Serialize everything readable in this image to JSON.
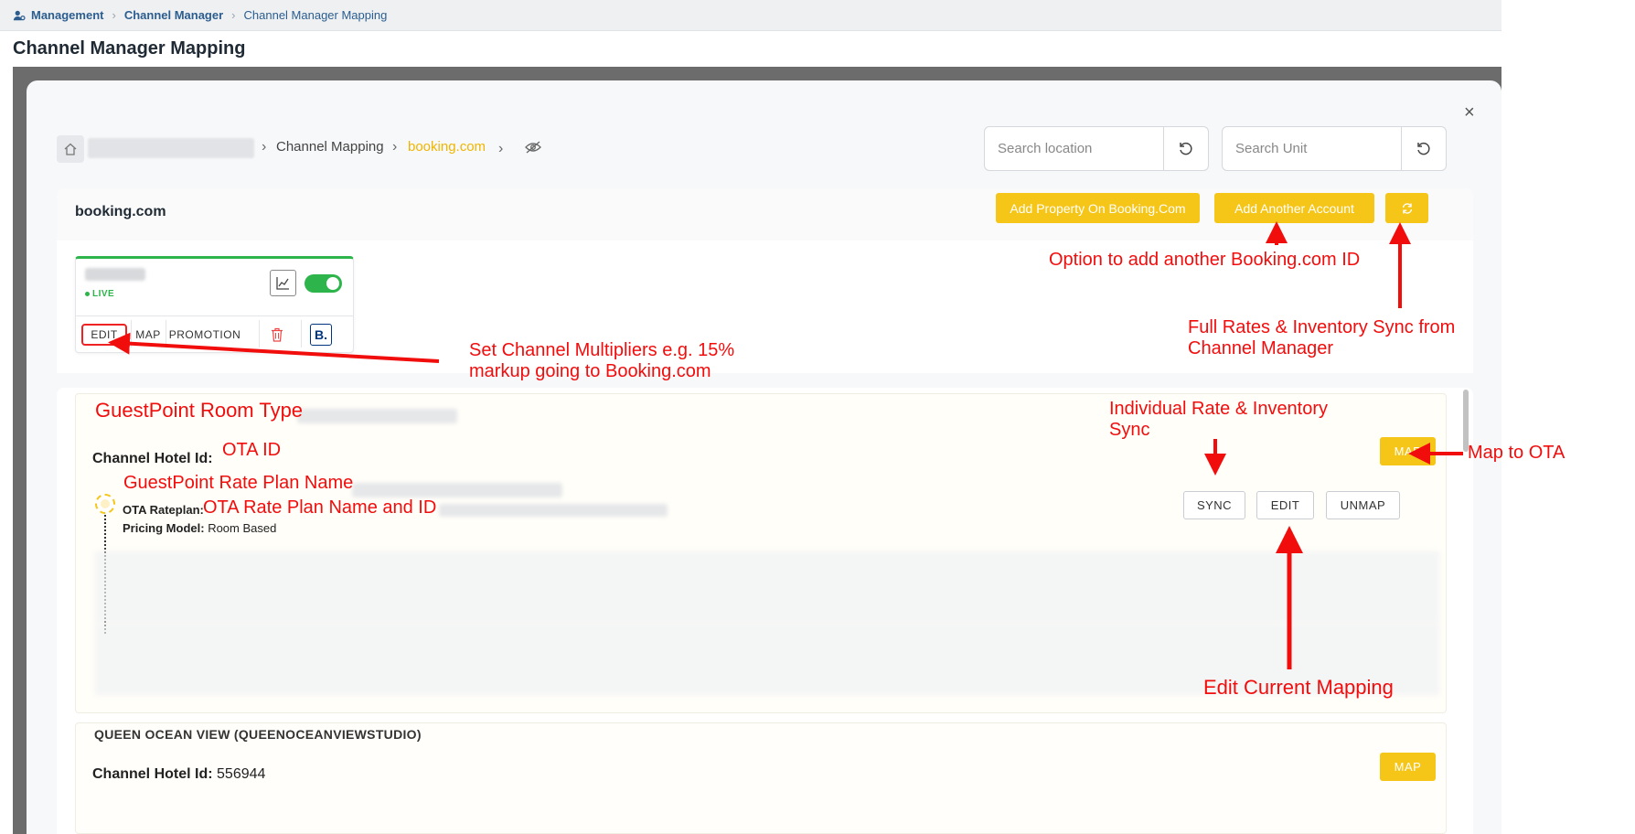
{
  "topbar": {
    "crumbs": [
      "Management",
      "Channel Manager",
      "Channel Manager Mapping"
    ]
  },
  "page": {
    "title": "Channel Manager Mapping"
  },
  "modal": {
    "close": "×",
    "breadcrumb": {
      "channel_mapping": "Channel Mapping",
      "provider": "booking.com"
    },
    "search_location": {
      "placeholder": "Search location"
    },
    "search_unit": {
      "placeholder": "Search Unit"
    }
  },
  "account": {
    "title": "booking.com",
    "add_property_label": "Add Property On Booking.Com",
    "add_account_label": "Add Another Account",
    "status": "LIVE",
    "actions": {
      "edit": "EDIT",
      "map": "MAP",
      "promotion": "PROMOTION",
      "booking_logo": "B."
    }
  },
  "rooms": [
    {
      "channel_hotel_label": "Channel Hotel Id:",
      "channel_hotel_id": "",
      "map_label": "MAP",
      "rate_plan": {
        "ota_rateplan_label": "OTA Rateplan:",
        "pricing_model_label": "Pricing Model:",
        "pricing_model_value": "Room Based",
        "sync_label": "SYNC",
        "edit_label": "EDIT",
        "unmap_label": "UNMAP"
      }
    },
    {
      "title": "QUEEN OCEAN VIEW (QUEENOCEANVIEWSTUDIO)",
      "channel_hotel_label": "Channel Hotel Id:",
      "channel_hotel_id": "556944",
      "map_label": "MAP"
    }
  ],
  "annotations": {
    "add_account": "Option to add another Booking.com ID",
    "full_sync": [
      "Full Rates & Inventory Sync from",
      "Channel Manager"
    ],
    "multipliers": [
      "Set Channel Multipliers e.g. 15%",
      "markup going to Booking.com"
    ],
    "room_type": "GuestPoint Room Type",
    "ota_id": "OTA ID",
    "individual_sync": [
      "Individual Rate & Inventory",
      "Sync"
    ],
    "map_to_ota": "Map to OTA",
    "rate_plan_name": "GuestPoint Rate Plan Name",
    "ota_rate_plan": "OTA Rate Plan Name and ID",
    "edit_mapping": "Edit Current Mapping"
  },
  "colors": {
    "accent": "#f5c518",
    "annotation": "#f20d0d",
    "live": "#2db54b",
    "link": "#2c5d8f"
  }
}
